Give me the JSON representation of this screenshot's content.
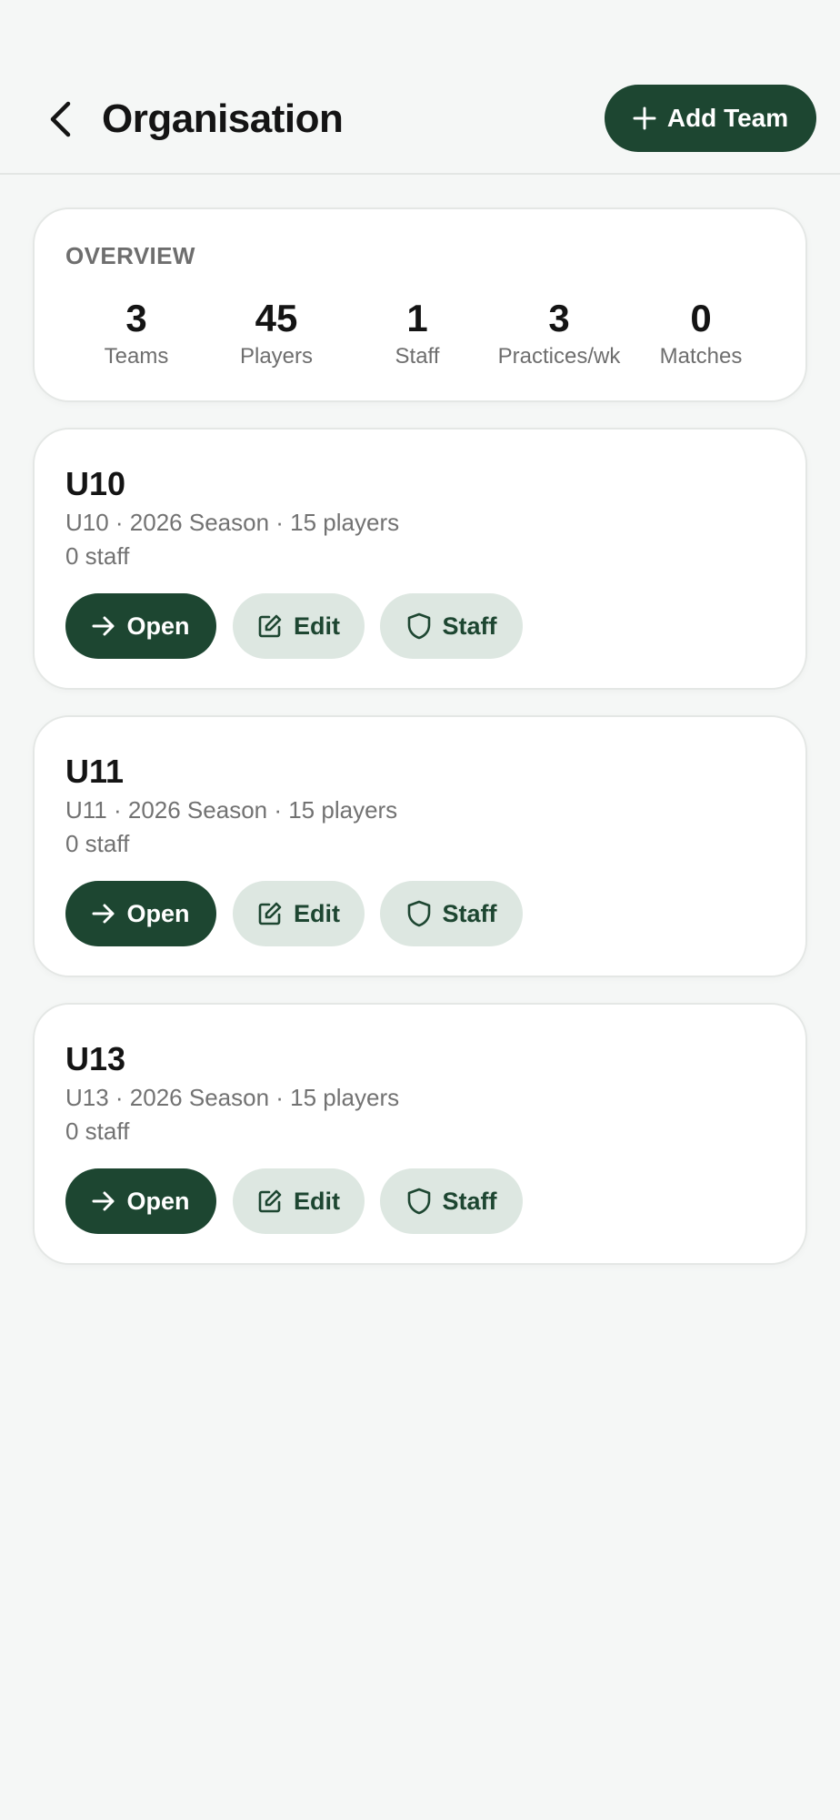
{
  "header": {
    "title": "Organisation",
    "add_team_label": "Add Team"
  },
  "overview": {
    "label": "OVERVIEW",
    "stats": [
      {
        "value": "3",
        "label": "Teams"
      },
      {
        "value": "45",
        "label": "Players"
      },
      {
        "value": "1",
        "label": "Staff"
      },
      {
        "value": "3",
        "label": "Practices/wk"
      },
      {
        "value": "0",
        "label": "Matches"
      }
    ]
  },
  "teams": [
    {
      "name": "U10",
      "meta": "U10 · 2026 Season · 15 players",
      "staff": "0 staff"
    },
    {
      "name": "U11",
      "meta": "U11 · 2026 Season · 15 players",
      "staff": "0 staff"
    },
    {
      "name": "U13",
      "meta": "U13 · 2026 Season · 15 players",
      "staff": "0 staff"
    }
  ],
  "actions": {
    "open_label": "Open",
    "edit_label": "Edit",
    "staff_label": "Staff"
  },
  "colors": {
    "primary": "#1d4631",
    "secondary_button": "#dde7e1",
    "background": "#f5f7f6"
  }
}
